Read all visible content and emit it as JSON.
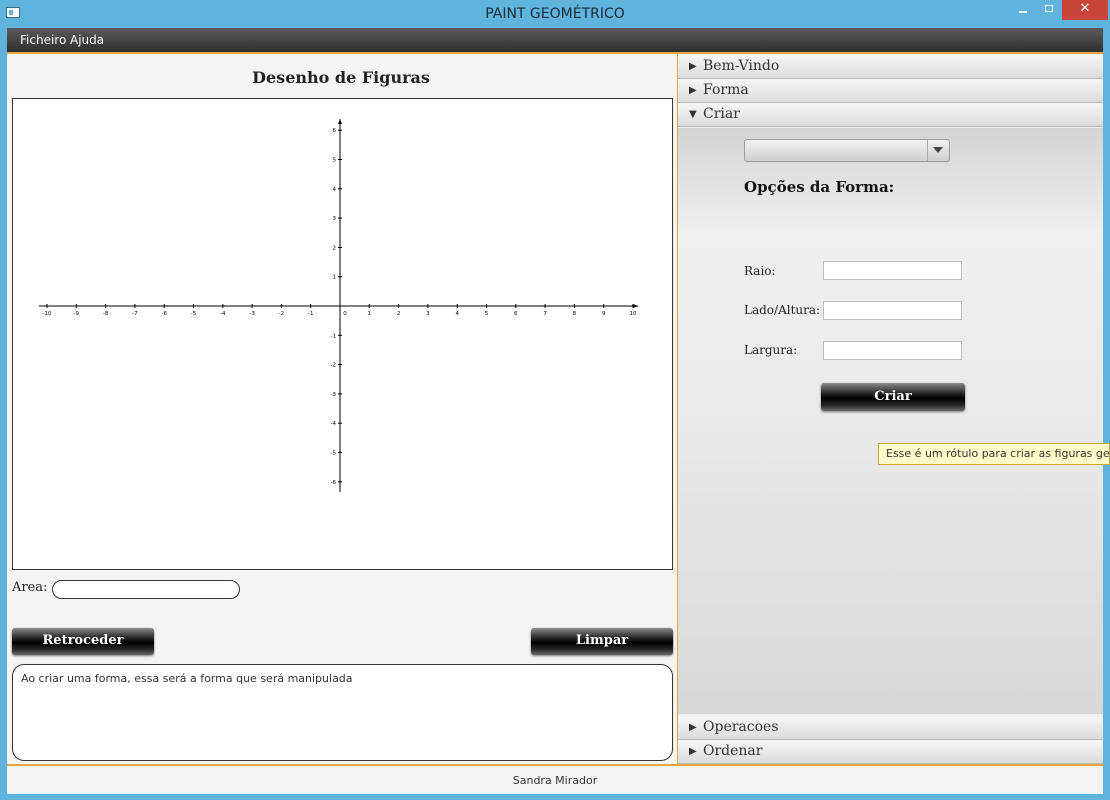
{
  "window": {
    "title": "PAINT GEOMÉTRICO",
    "minimize_glyph": "_",
    "close_glyph": "✕"
  },
  "menu": {
    "items": [
      "Ficheiro",
      "Ajuda"
    ]
  },
  "left_panel": {
    "title": "Desenho de Figuras",
    "axes": {
      "x_ticks": [
        "-10",
        "-9",
        "-8",
        "-7",
        "-6",
        "-5",
        "-4",
        "-3",
        "-2",
        "-1",
        "0",
        "1",
        "2",
        "3",
        "4",
        "5",
        "6",
        "7",
        "8",
        "9",
        "10"
      ],
      "y_ticks": [
        "6",
        "5",
        "4",
        "3",
        "2",
        "1",
        "-1",
        "-2",
        "-3",
        "-4",
        "-5",
        "-6"
      ]
    },
    "area_label": "Area:",
    "area_value": "",
    "back_button": "Retroceder",
    "clear_button": "Limpar",
    "message": "Ao criar uma forma, essa será a forma que será manipulada"
  },
  "right_panel": {
    "sections": [
      {
        "label": "Bem-Vindo",
        "expanded": false
      },
      {
        "label": "Forma",
        "expanded": false
      },
      {
        "label": "Criar",
        "expanded": true
      },
      {
        "label": "Operacoes",
        "expanded": false
      },
      {
        "label": "Ordenar",
        "expanded": false
      }
    ],
    "shape_combo_value": "",
    "options_title": "Opções da Forma:",
    "fields": {
      "raio_label": "Raio:",
      "lado_label": "Lado/Altura:",
      "largura_label": "Largura:"
    },
    "create_button": "Criar",
    "tooltip": "Esse é um rótulo para criar as figuras geométricas"
  },
  "status": {
    "author": "Sandra Mirador"
  }
}
